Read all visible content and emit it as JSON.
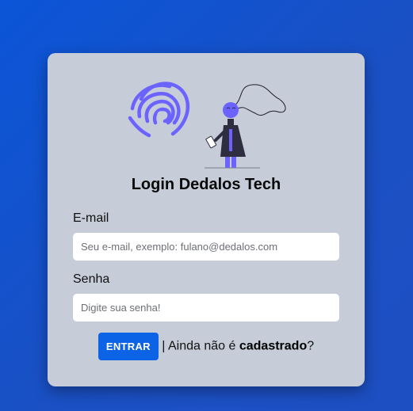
{
  "login": {
    "title": "Login Dedalos Tech",
    "email_label": "E-mail",
    "email_placeholder": "Seu e-mail, exemplo: fulano@dedalos.com",
    "password_label": "Senha",
    "password_placeholder": "Digite sua senha!",
    "submit_label": "ENTRAR",
    "signup_prefix": " | Ainda não é ",
    "signup_link": "cadastrado",
    "signup_suffix": "?"
  },
  "illustration": {
    "fingerprint_icon": "fingerprint-icon",
    "person_icon": "person-with-phone-icon",
    "accent_color": "#6c63ff"
  },
  "colors": {
    "background": "#0b55d8",
    "card": "#c6ccd8",
    "button": "#0d63e6"
  }
}
